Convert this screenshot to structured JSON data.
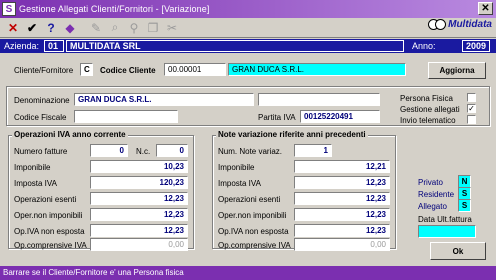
{
  "window": {
    "title": "Gestione Allegati Clienti/Fornitori - [Variazione]",
    "close_glyph": "✕",
    "app_icon": "S"
  },
  "toolbar": {
    "icons": [
      "close-icon",
      "check-icon",
      "help-icon",
      "diamond-icon",
      "edit-icon",
      "search-icon",
      "binoculars-icon",
      "copy-icon",
      "delete-icon"
    ],
    "brand": "Multidata"
  },
  "company": {
    "azienda_label": "Azienda:",
    "azienda_code": "01",
    "azienda_name": "MULTIDATA SRL",
    "anno_label": "Anno:",
    "anno_value": "2009"
  },
  "client": {
    "type_label": "Cliente/Fornitore",
    "type_value": "C",
    "code_label": "Codice Cliente",
    "code_value": "00.00001",
    "name_value": "GRAN DUCA S.R.L.",
    "update_button": "Aggiorna"
  },
  "details": {
    "denominazione_label": "Denominazione",
    "denominazione_value": "GRAN DUCA S.R.L.",
    "denominazione_extra": "",
    "codice_fiscale_label": "Codice Fiscale",
    "codice_fiscale_value": "",
    "partita_iva_label": "Partita IVA",
    "partita_iva_value": "00125220491"
  },
  "flags": {
    "persona_fisica_label": "Persona Fisica",
    "persona_fisica_checked": false,
    "gestione_allegati_label": "Gestione allegati",
    "gestione_allegati_checked": true,
    "invio_telematico_label": "Invio telematico",
    "invio_telematico_checked": false,
    "check_glyph": "✓"
  },
  "operazioni_iva": {
    "title": "Operazioni IVA anno corrente",
    "numero_fatture_label": "Numero fatture",
    "numero_fatture_value": "0",
    "nc_label": "N.c.",
    "nc_value": "0",
    "imponibile_label": "Imponibile",
    "imponibile_value": "10,23",
    "imposta_label": "Imposta IVA",
    "imposta_value": "120,23",
    "esenti_label": "Operazioni esenti",
    "esenti_value": "12,23",
    "non_imponibili_label": "Oper.non imponibili",
    "non_imponibili_value": "12,23",
    "non_esposta_label": "Op.IVA non esposta",
    "non_esposta_value": "12,23",
    "comprensive_label": "Op.comprensive IVA",
    "comprensive_value": "0,00"
  },
  "note_variazione": {
    "title": "Note variazione riferite anni precedenti",
    "num_note_label": "Num. Note variaz.",
    "num_note_value": "1",
    "imponibile_label": "Imponibile",
    "imponibile_value": "12,21",
    "imposta_label": "Imposta IVA",
    "imposta_value": "12,23",
    "esenti_label": "Operazioni esenti",
    "esenti_value": "12,23",
    "non_imponibili_label": "Oper.non imponibili",
    "non_imponibili_value": "12,23",
    "non_esposta_label": "Op.IVA non esposta",
    "non_esposta_value": "12,23",
    "comprensive_label": "Op.comprensive IVA",
    "comprensive_value": "0,00"
  },
  "status_flags": {
    "privato_label": "Privato",
    "privato_value": "N",
    "residente_label": "Residente",
    "residente_value": "S",
    "allegato_label": "Allegato",
    "allegato_value": "S",
    "data_ult_label": "Data Ult.fattura",
    "data_ult_value": ""
  },
  "actions": {
    "ok_button": "Ok"
  },
  "statusbar": {
    "text": "Barrare se il Cliente/Fornitore e' una Persona fisica"
  },
  "colors": {
    "title_purple": "#7b2fb0",
    "navy": "#1a1aa0",
    "cyan": "#00ffff",
    "face": "#d4d0c8"
  }
}
